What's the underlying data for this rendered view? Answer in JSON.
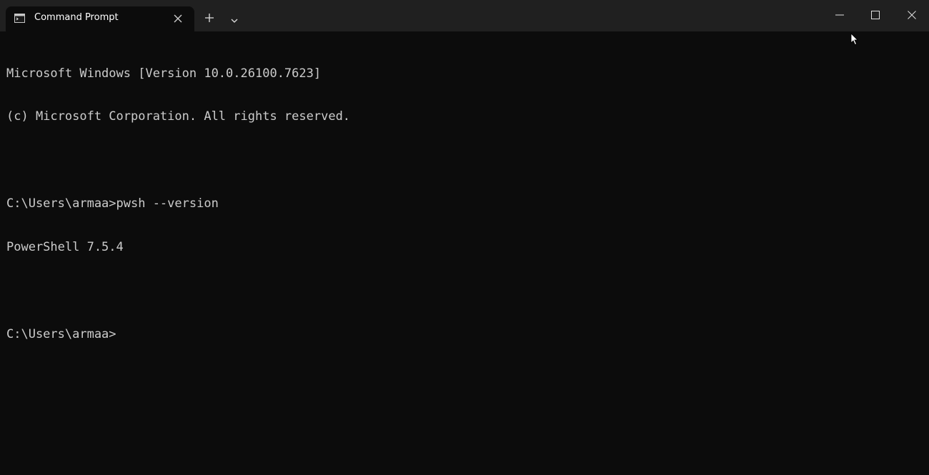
{
  "tab": {
    "title": "Command Prompt",
    "icon": "cmd-icon"
  },
  "toolbar": {
    "new_tab_icon": "plus-icon",
    "dropdown_icon": "chevron-down-icon"
  },
  "window_controls": {
    "minimize_icon": "minimize-icon",
    "maximize_icon": "maximize-icon",
    "close_icon": "close-icon"
  },
  "terminal": {
    "lines": [
      "Microsoft Windows [Version 10.0.26100.7623]",
      "(c) Microsoft Corporation. All rights reserved.",
      "",
      "C:\\Users\\armaa>pwsh --version",
      "PowerShell 7.5.4",
      "",
      "C:\\Users\\armaa>"
    ]
  },
  "colors": {
    "titlebar": "#202020",
    "background": "#0c0c0c",
    "text": "#cccccc"
  }
}
